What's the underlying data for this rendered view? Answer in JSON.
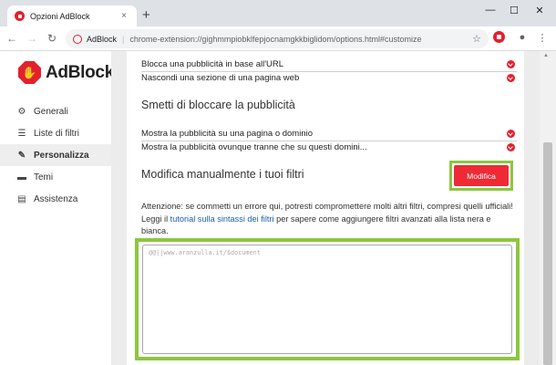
{
  "browser": {
    "tab_title": "Opzioni AdBlock",
    "tab_close": "×",
    "new_tab": "+",
    "window_controls": {
      "minimize": "—",
      "maximize": "☐",
      "close": "✕"
    },
    "nav": {
      "back": "←",
      "forward": "→",
      "reload": "↻"
    },
    "omnibox": {
      "app_name": "AdBlock",
      "separator": "|",
      "url": "chrome-extension://gighmmpiobklfepjocnamgkkbiglidom/options.html#customize"
    },
    "icons": {
      "star": "☆",
      "account": "●",
      "menu": "⋮"
    }
  },
  "sidebar": {
    "logo_glyph": "✋",
    "logo_text": "AdBlock",
    "items": [
      {
        "label": "Generali",
        "icon": "⚙",
        "icon_name": "gear-icon",
        "active": false
      },
      {
        "label": "Liste di filtri",
        "icon": "☰",
        "icon_name": "list-icon",
        "active": false
      },
      {
        "label": "Personalizza",
        "icon": "✎",
        "icon_name": "pencil-icon",
        "active": true
      },
      {
        "label": "Temi",
        "icon": "▬",
        "icon_name": "theme-icon",
        "active": false
      },
      {
        "label": "Assistenza",
        "icon": "▤",
        "icon_name": "chat-icon",
        "active": false
      }
    ]
  },
  "main": {
    "block_items": [
      "Blocca una pubblicità in base all'URL",
      "Nascondi una sezione di una pagina web"
    ],
    "section_unblock_title": "Smetti di bloccare la pubblicità",
    "unblock_items": [
      "Mostra la pubblicità su una pagina o dominio",
      "Mostra la pubblicità ovunque tranne che su questi domini..."
    ],
    "manual_title": "Modifica manualmente i tuoi filtri",
    "modifica_button": "Modifica",
    "warning_text": "Attenzione: se commetti un errore qui, potresti compromettere molti altri filtri, compresi quelli ufficiali!",
    "help_prefix": "Leggi il ",
    "help_link": "tutorial sulla sintassi dei filtri",
    "help_suffix": " per sapere come aggiungere filtri avanzati alla lista nera e bianca.",
    "filter_text": "@@||www.aranzulla.it/$document"
  },
  "colors": {
    "accent": "#e4202e",
    "highlight": "#8dc63f",
    "link": "#1a5fb4"
  }
}
